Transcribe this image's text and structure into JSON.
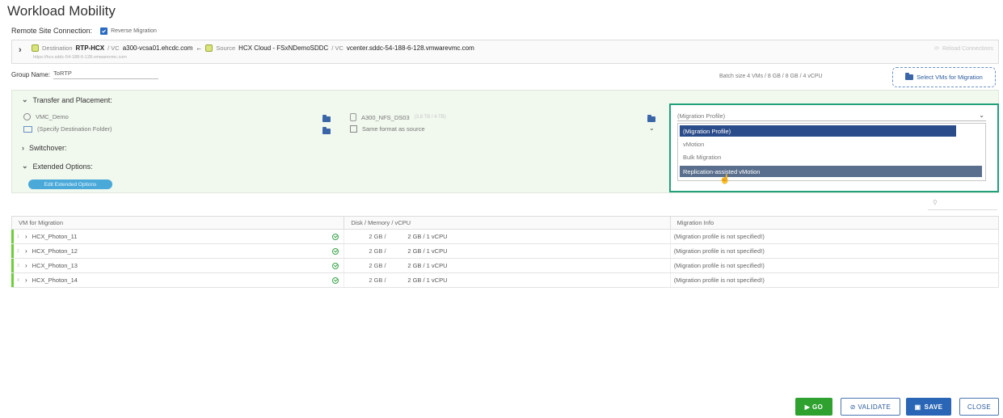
{
  "page": {
    "title": "Workload Mobility"
  },
  "remote": {
    "label": "Remote Site Connection:",
    "reverse_label": "Reverse Migration",
    "reverse_checked": true
  },
  "connection": {
    "dest_prefix": "Destination",
    "dest_name": "RTP-HCX",
    "vc_prefix": "/  VC",
    "dest_vc": "a300-vcsa01.ehcdc.com",
    "arrow": "←",
    "source_prefix": "Source",
    "source_name": "HCX Cloud - FSxNDemoSDDC",
    "vc_prefix2": "/  VC",
    "source_vc": "vcenter.sddc-54-188-6-128.vmwarevmc.com",
    "url": "https://hcx.sddc-54-188-6-128.vmwarevmc.com",
    "reload_label": "Reload Connections"
  },
  "group": {
    "label": "Group Name:",
    "value": "ToRTP"
  },
  "batch": {
    "text": "Batch size   4 VMs  /     8 GB /     8 GB /  4 vCPU"
  },
  "select_vms_label": "Select VMs for Migration",
  "transfer": {
    "title": "Transfer and Placement:",
    "compute": "VMC_Demo",
    "folder": "(Specify Destination Folder)",
    "datastore": "A300_NFS_DS03",
    "datastore_size": "(3.8 TB / 4 TB)",
    "format": "Same format as source"
  },
  "switchover": {
    "title": "Switchover:"
  },
  "extended": {
    "title": "Extended Options:",
    "button": "Edit Extended Options"
  },
  "profile": {
    "placeholder": "(Migration Profile)",
    "options": [
      "(Migration Profile)",
      "vMotion",
      "Bulk Migration",
      "Replication-assisted vMotion"
    ],
    "selected": "(Migration Profile)",
    "hovered": "Replication-assisted vMotion"
  },
  "table": {
    "headers": [
      "VM for Migration",
      "Disk / Memory / vCPU",
      "Migration Info"
    ],
    "rows": [
      {
        "num": "1",
        "name": "HCX_Photon_11",
        "disk": "2 GB /",
        "mem": "2 GB / 1 vCPU",
        "info": "(Migration profile is not specified!)"
      },
      {
        "num": "2",
        "name": "HCX_Photon_12",
        "disk": "2 GB /",
        "mem": "2 GB / 1 vCPU",
        "info": "(Migration profile is not specified!)"
      },
      {
        "num": "3",
        "name": "HCX_Photon_13",
        "disk": "2 GB /",
        "mem": "2 GB / 1 vCPU",
        "info": "(Migration profile is not specified!)"
      },
      {
        "num": "4",
        "name": "HCX_Photon_14",
        "disk": "2 GB /",
        "mem": "2 GB / 1 vCPU",
        "info": "(Migration profile is not specified!)"
      }
    ]
  },
  "footer": {
    "go": "▶ GO",
    "validate": "⊘ VALIDATE",
    "save": "SAVE",
    "close": "CLOSE"
  },
  "colors": {
    "accent": "#2a66b5",
    "go": "#2fa12f",
    "highlight_border": "#21a07a",
    "row_marker": "#6ccf3a"
  }
}
